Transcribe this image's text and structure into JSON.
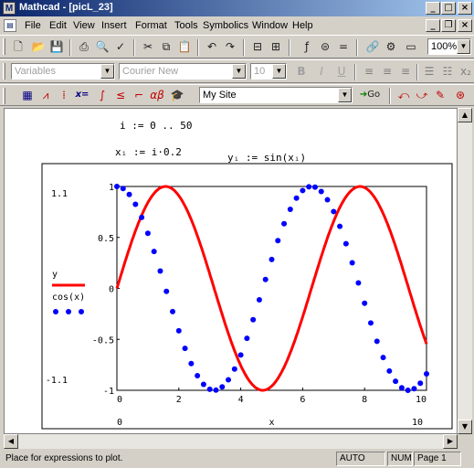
{
  "window": {
    "title": "Mathcad - [picL_23]"
  },
  "menu": [
    "File",
    "Edit",
    "View",
    "Insert",
    "Format",
    "Tools",
    "Symbolics",
    "Window",
    "Help"
  ],
  "toolbar": {
    "zoom": "100%"
  },
  "format_bar": {
    "style": "Variables",
    "font": "Courier New",
    "size": "10"
  },
  "math_bar": {
    "resource": "My Site",
    "go_label": "Go"
  },
  "worksheet": {
    "range_def": "i := 0 .. 50",
    "x_def": "xᵢ := i·0.2",
    "y_def": "yᵢ := sin(xᵢ)"
  },
  "chart_data": {
    "type": "line",
    "x_var": "x",
    "x_range": [
      0,
      10
    ],
    "y_range": [
      -1,
      1
    ],
    "xlim_labels": [
      "0",
      "10"
    ],
    "ylim_labels": [
      "1.1",
      "-1.1"
    ],
    "x_ticks": [
      "0",
      "2",
      "4",
      "6",
      "8",
      "10"
    ],
    "y_ticks": [
      "1",
      "0.5",
      "0",
      "-0.5",
      "-1"
    ],
    "series": [
      {
        "name": "y",
        "style": "line",
        "color": "#ff0000",
        "func": "sin",
        "x_start": 0,
        "x_step": 0.2,
        "count": 51
      },
      {
        "name": "cos(x)",
        "style": "points",
        "color": "#0000ff",
        "func": "cos",
        "x_start": 0,
        "x_step": 0.2,
        "count": 51
      }
    ]
  },
  "status": {
    "message": "Place for expressions to plot.",
    "mode": "AUTO",
    "num": "NUM",
    "page": "Page 1"
  }
}
